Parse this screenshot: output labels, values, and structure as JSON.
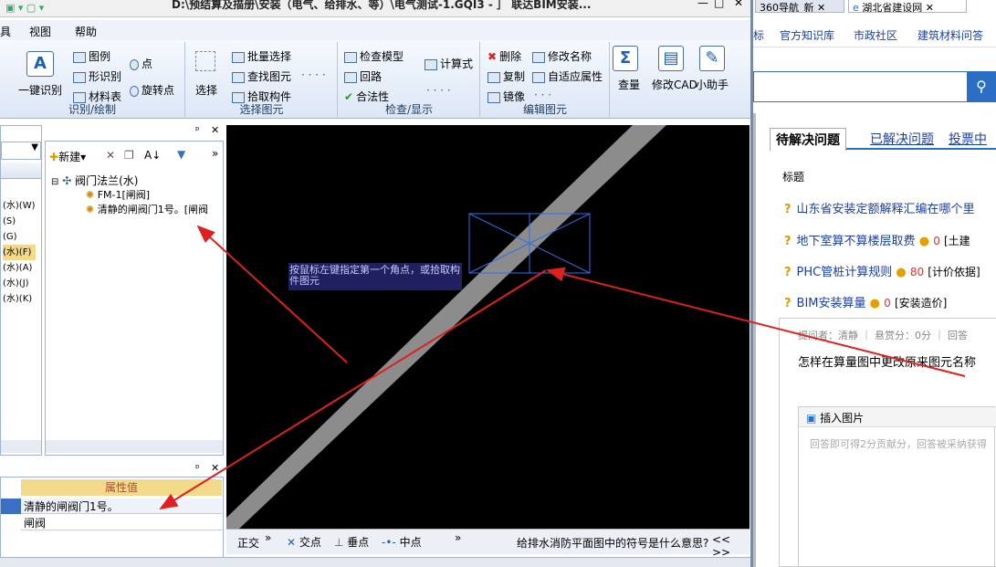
{
  "window": {
    "title": "D:\\预结算及描册\\安装（电气、给排水、等）\\电气测试-1.GQI3 - ］ 联达BIM安装...",
    "min": "—",
    "max": "□",
    "close": "✕"
  },
  "menu": [
    "具",
    "视图",
    "帮助"
  ],
  "ribbon": {
    "g1": {
      "big": "一键识别",
      "items": [
        "图例",
        "形识别",
        "材料表",
        "点",
        "旋转点"
      ],
      "label": "识别/绘制"
    },
    "g2": {
      "big": "选择",
      "items": [
        "批量选择",
        "查找图元",
        "拾取构件"
      ],
      "more": "· · · ·",
      "label": "选择图元"
    },
    "g3": {
      "items": [
        "检查模型",
        "回路",
        "合法性",
        "计算式"
      ],
      "more": "· · · ·",
      "label": "检查/显示"
    },
    "g4": {
      "items": [
        "删除",
        "修改名称",
        "复制",
        "自适应属性",
        "镜像"
      ],
      "more": "· · ·",
      "label": "编辑图元"
    },
    "g5": {
      "items": [
        "查量",
        "修改CAD",
        "小助手"
      ]
    }
  },
  "left": {
    "rows": [
      "(水)(W)",
      "(S)",
      "(G)",
      "(水)(F)",
      "(水)(A)",
      "(水)(J)",
      "(水)(K)"
    ],
    "pin": "ᵖ",
    "x": "✕"
  },
  "tree": {
    "toolbar": {
      "new": "新建",
      "sort": "A↓"
    },
    "root": "阀门法兰(水)",
    "children": [
      "FM-1[闸阀]",
      "清静的闸阀门1号。[闸阀"
    ]
  },
  "props": {
    "header": "属性值",
    "rows": [
      "清静的闸阀门1号。",
      "闸阀"
    ],
    "pin": "ᵖ",
    "x": "✕"
  },
  "canvas": {
    "hint": "按鼠标左键指定第一个角点，或拾取构件图元"
  },
  "status": {
    "items": [
      "正交",
      "交点",
      "垂点",
      "中点"
    ],
    "question": "给排水消防平面图中的符号是什么意思?",
    "nav": "<< >>",
    "more": "»"
  },
  "browser": {
    "tabs": [
      "360导航_新",
      "湖北省建设网"
    ],
    "nav": [
      "标",
      "官方知识库",
      "市政社区",
      "建筑材料问答"
    ],
    "qtabs": [
      "待解决问题",
      "已解决问题",
      "投票中"
    ],
    "col": "标题",
    "questions": [
      {
        "t": "山东省安装定额解释汇编在哪个里",
        "score": "",
        "tag": ""
      },
      {
        "t": "地下室算不算楼层取费",
        "score": "0",
        "tag": "[土建"
      },
      {
        "t": "PHC管桩计算规则",
        "score": "80",
        "tag": "[计价依据]"
      },
      {
        "t": "BIM安装算量",
        "score": "0",
        "tag": "[安装造价]"
      }
    ],
    "meta": "提问者：清静  ｜ 悬赏分：0分  ｜ 回答",
    "question": "怎样在算量图中更改原来图元名称",
    "insert": "插入图片",
    "placeholder": "回答即可得2分贡献分，回答被采纳获得"
  },
  "colors": {
    "accent": "#1a3ea9",
    "ribbon": "#dce7f6",
    "canvas": "#000000",
    "arrow": "#e02020"
  }
}
